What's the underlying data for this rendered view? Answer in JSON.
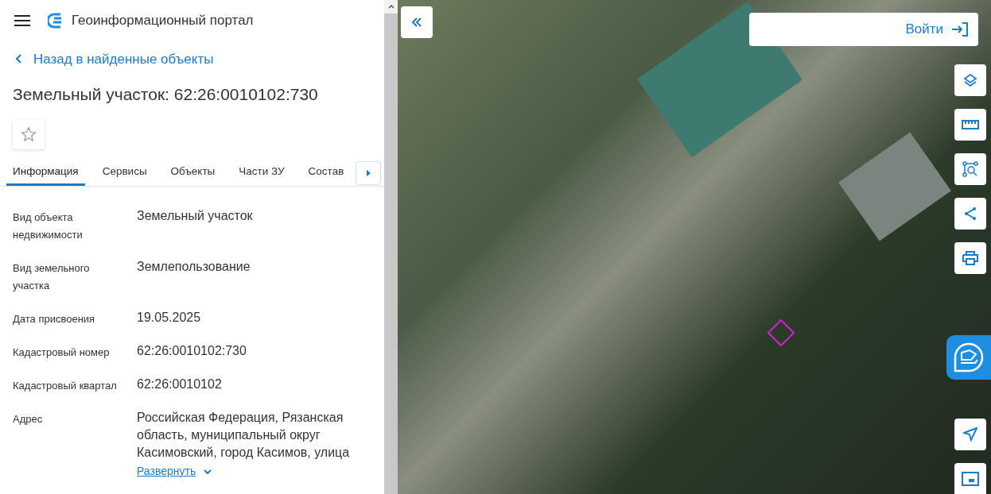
{
  "header": {
    "title": "Геоинформационный портал"
  },
  "back_link": "Назад в найденные объекты",
  "object_title": "Земельный участок: 62:26:0010102:730",
  "favorite": {
    "on": false
  },
  "tabs": [
    {
      "label": "Информация",
      "selected": true
    },
    {
      "label": "Сервисы",
      "selected": false
    },
    {
      "label": "Объекты",
      "selected": false
    },
    {
      "label": "Части ЗУ",
      "selected": false
    },
    {
      "label": "Состав",
      "selected": false
    }
  ],
  "fields": [
    {
      "label": "Вид объекта недвижимости",
      "value": "Земельный участок"
    },
    {
      "label": "Вид земельного участка",
      "value": "Землепользование"
    },
    {
      "label": "Дата присвоения",
      "value": "19.05.2025"
    },
    {
      "label": "Кадастровый номер",
      "value": "62:26:0010102:730"
    },
    {
      "label": "Кадастровый квартал",
      "value": "62:26:0010102"
    },
    {
      "label": "Адрес",
      "value": "Российская Федерация, Рязанская область, муниципальный округ Касимовский, город Касимов, улица",
      "expand": "Развернуть"
    }
  ],
  "map": {
    "login": "Войти"
  }
}
